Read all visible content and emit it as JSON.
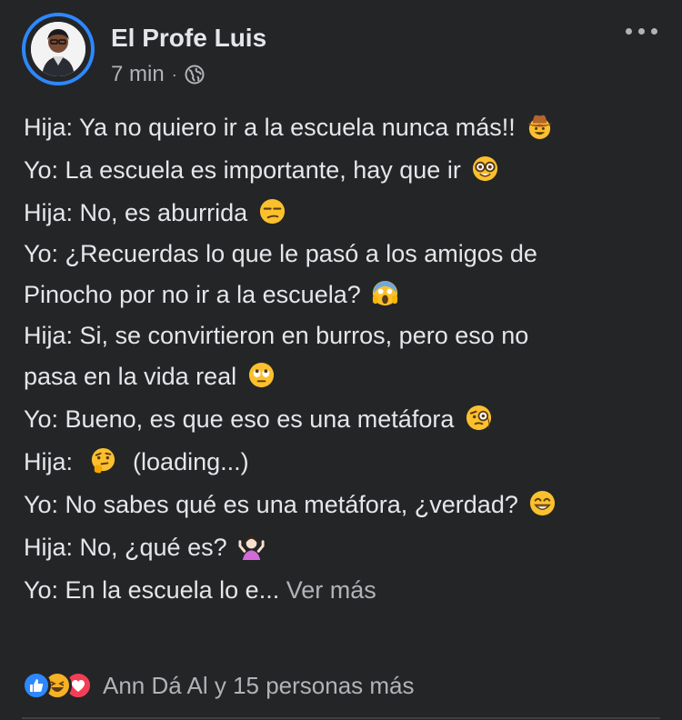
{
  "post": {
    "author": "El Profe Luis",
    "time": "7 min",
    "separator": "·",
    "privacy_icon": "globe-icon",
    "menu_icon": "more-horizontal-icon",
    "lines": [
      {
        "text": "Hija: Ya no quiero ir a la escuela nunca más!!",
        "emoji": "cowboy-face-emoji"
      },
      {
        "text": "Yo: La escuela es importante, hay que ir",
        "emoji": "nerd-face-emoji"
      },
      {
        "text": "Hija: No, es aburrida",
        "emoji": "unamused-face-emoji"
      },
      {
        "text": "Yo: ¿Recuerdas lo que le pasó a los amigos de",
        "emoji": ""
      },
      {
        "text": "Pinocho por no ir a la escuela?",
        "emoji": "screaming-face-emoji"
      },
      {
        "text": "Hija: Si, se convirtieron en burros, pero eso no",
        "emoji": ""
      },
      {
        "text": "pasa en la vida real",
        "emoji": "eye-roll-face-emoji"
      },
      {
        "text": "Yo: Bueno, es que eso es una metáfora",
        "emoji": "monocle-face-emoji"
      },
      {
        "text_before": "Hija:",
        "text_after": "(loading...)",
        "emoji": "thinking-face-emoji"
      },
      {
        "text": "Yo: No sabes qué es una metáfora, ¿verdad?",
        "emoji": "grinning-face-emoji"
      },
      {
        "text": "Hija: No, ¿qué es?",
        "emoji": "person-shrugging-emoji"
      },
      {
        "text": "Yo: En la escuela lo e...",
        "emoji": ""
      }
    ],
    "see_more": "Ver más"
  },
  "reactions": {
    "icons": [
      "like-icon",
      "haha-icon",
      "love-icon"
    ],
    "summary": "Ann Dá Al y 15 personas más",
    "colors": {
      "like": "#2d88ff",
      "haha": "#f7b125",
      "love": "#f33e58"
    }
  },
  "theme": {
    "background": "#242526",
    "text": "#e4e6eb",
    "secondary": "#b0b3b8",
    "accent": "#2d88ff"
  }
}
